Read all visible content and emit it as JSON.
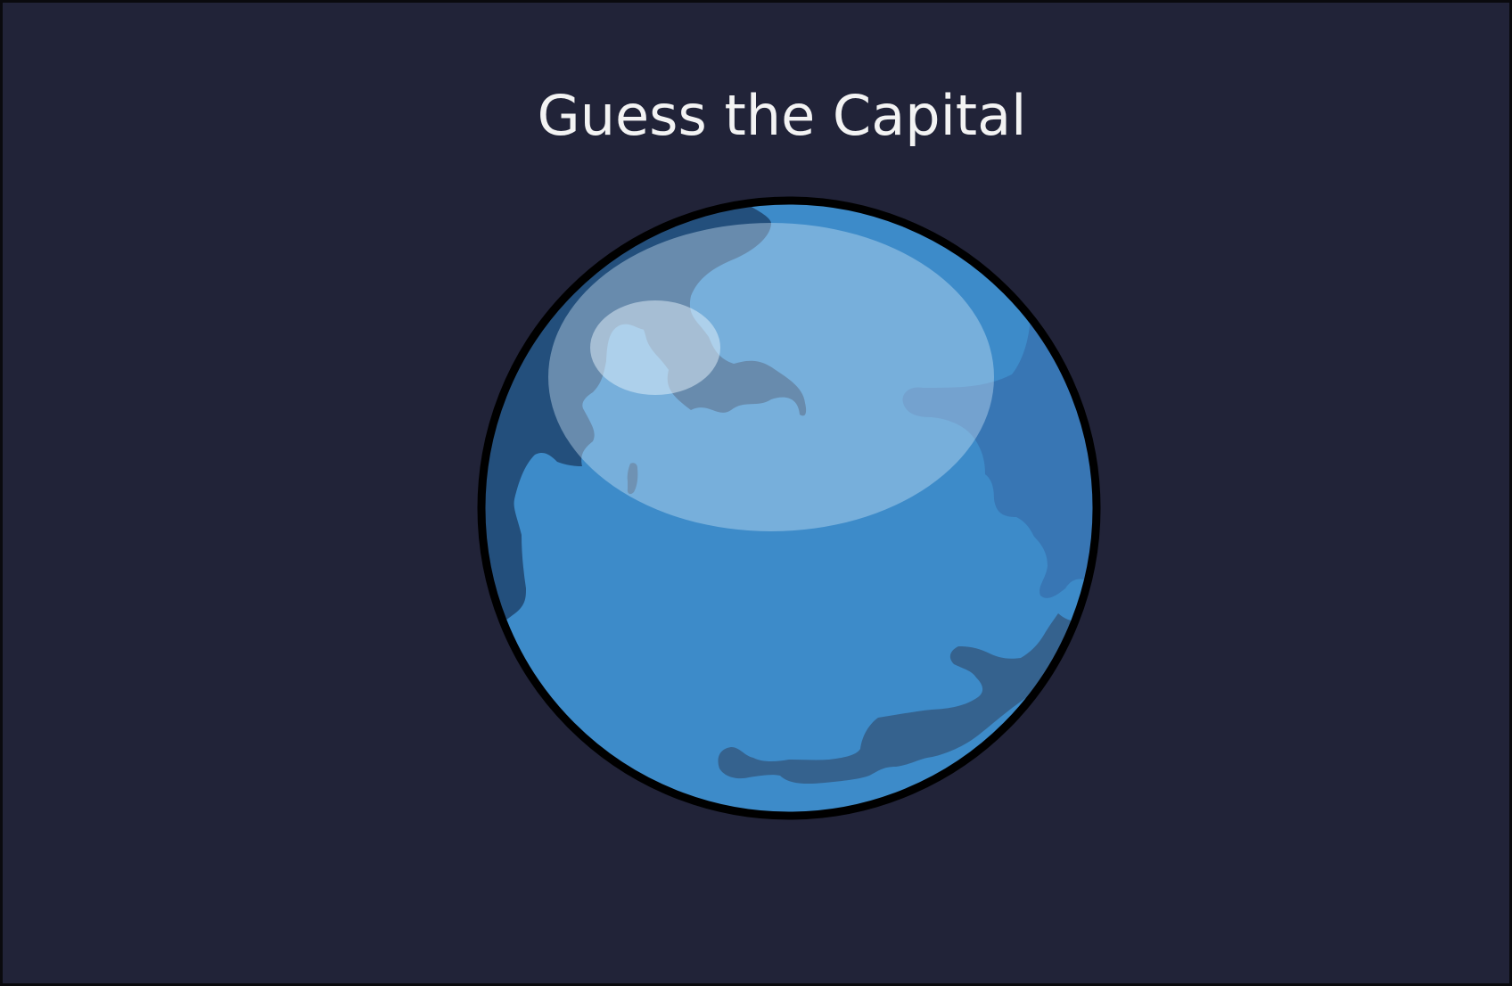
{
  "game": {
    "title": "Guess the Capital"
  },
  "colors": {
    "background": "#212338",
    "ocean": "#3d8bc9",
    "land_shadow": "#2c4f77",
    "highlight": "#cfe6f7",
    "outline": "#000000",
    "title_text": "#f3f3f3"
  },
  "globe": {
    "icon": "globe-icon"
  }
}
